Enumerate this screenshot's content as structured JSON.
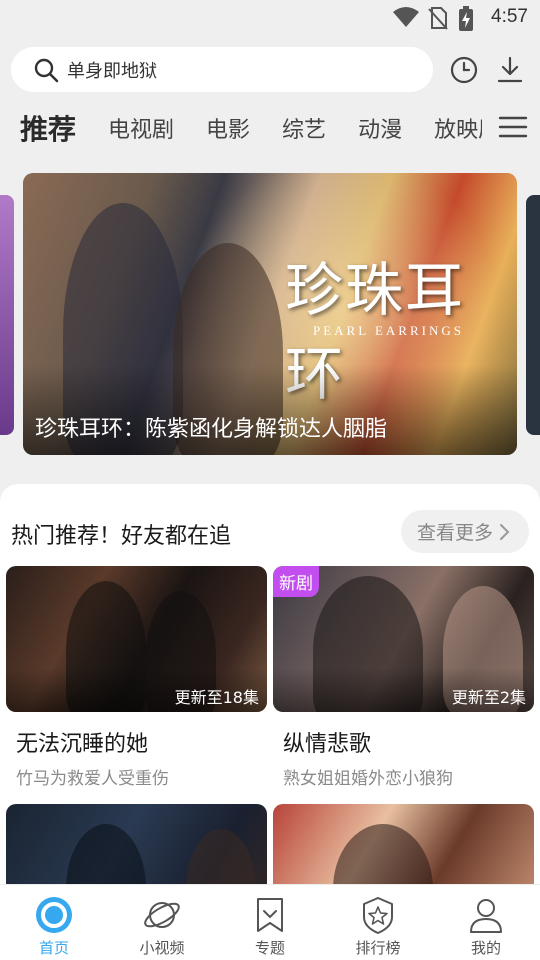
{
  "status_bar": {
    "time": "4:57"
  },
  "search": {
    "query": "单身即地狱"
  },
  "tabs": [
    {
      "label": "推荐",
      "active": true
    },
    {
      "label": "电视剧"
    },
    {
      "label": "电影"
    },
    {
      "label": "综艺"
    },
    {
      "label": "动漫"
    },
    {
      "label": "放映厅"
    }
  ],
  "banner": {
    "logo_text": "珍珠耳环",
    "logo_sub": "PEARL EARRINGS",
    "title": "珍珠耳环：陈紫函化身解锁达人胭脂"
  },
  "section": {
    "title": "热门推荐！好友都在追",
    "more_label": "查看更多"
  },
  "cards": [
    {
      "title": "无法沉睡的她",
      "subtitle": "竹马为救爱人受重伤",
      "episodes": "更新至18集",
      "badge": ""
    },
    {
      "title": "纵情悲歌",
      "subtitle": "熟女姐姐婚外恋小狼狗",
      "episodes": "更新至2集",
      "badge": "新剧"
    }
  ],
  "nav": [
    {
      "label": "首页",
      "icon": "home-ring-icon",
      "active": true
    },
    {
      "label": "小视频",
      "icon": "planet-icon"
    },
    {
      "label": "专题",
      "icon": "bookmark-icon"
    },
    {
      "label": "排行榜",
      "icon": "ranking-shield-icon"
    },
    {
      "label": "我的",
      "icon": "person-icon"
    }
  ],
  "colors": {
    "accent": "#35a8f0",
    "badge": "#c34ef0",
    "background": "#efefef"
  }
}
